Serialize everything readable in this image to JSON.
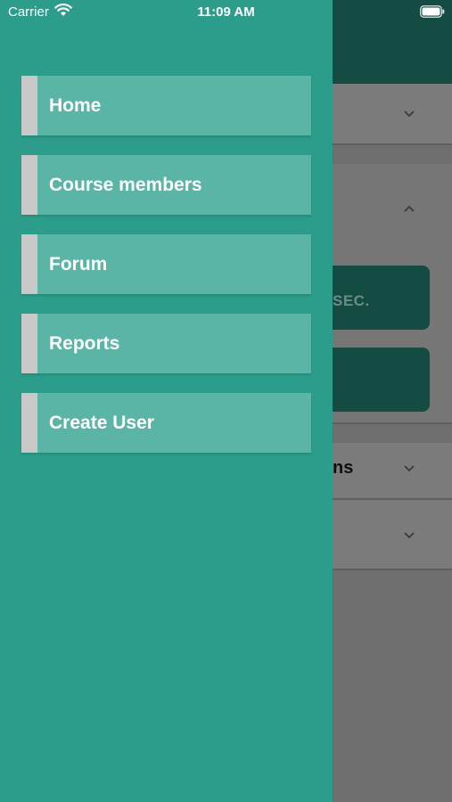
{
  "status_bar": {
    "carrier": "Carrier",
    "time": "11:09 AM",
    "icons": [
      "wifi-icon",
      "battery-icon"
    ]
  },
  "drawer": {
    "items": [
      {
        "label": "Home"
      },
      {
        "label": "Course members"
      },
      {
        "label": "Forum"
      },
      {
        "label": "Reports"
      },
      {
        "label": "Create User"
      }
    ]
  },
  "background": {
    "button_1_text": "SEC.",
    "row_text": "ns",
    "icons": [
      "chevron-down-icon",
      "chevron-up-icon"
    ]
  },
  "colors": {
    "drawer": "#2b9d8a",
    "menu_item": "#5bb5a6",
    "menu_accent": "#c8c8c8",
    "header_dark": "#144b43",
    "overlay": "#6e6e6e"
  }
}
